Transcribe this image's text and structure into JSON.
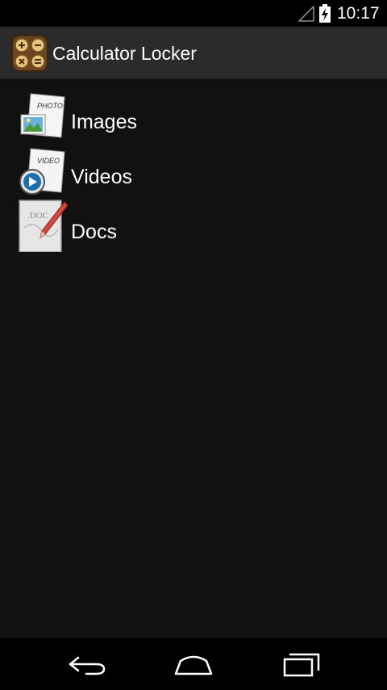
{
  "status_bar": {
    "time": "10:17",
    "signal_icon": "signal-icon",
    "battery_icon": "battery-charging-icon"
  },
  "action_bar": {
    "app_icon": "calculator-icon",
    "title": "Calculator Locker"
  },
  "folders": [
    {
      "label": "Images",
      "icon": "photo-icon",
      "icon_text": "PHOTO"
    },
    {
      "label": "Videos",
      "icon": "video-icon",
      "icon_text": "VIDEO"
    },
    {
      "label": "Docs",
      "icon": "doc-icon",
      "icon_text": ".DOC"
    }
  ],
  "nav_bar": {
    "back_icon": "back-icon",
    "home_icon": "home-icon",
    "recents_icon": "recents-icon"
  },
  "colors": {
    "background": "#111111",
    "action_bar": "#2b2b2b",
    "status_bar": "#000000",
    "nav_bar": "#000000"
  }
}
